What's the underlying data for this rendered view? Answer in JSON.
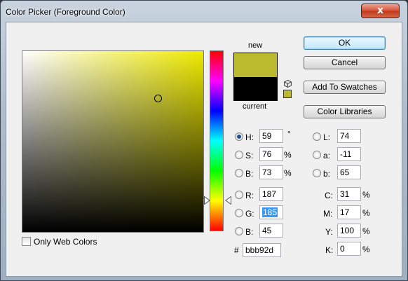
{
  "window": {
    "title": "Color Picker (Foreground Color)",
    "close_label": "x"
  },
  "colors": {
    "new": "#bbb92d",
    "current": "#000000"
  },
  "preview": {
    "new_label": "new",
    "current_label": "current"
  },
  "buttons": {
    "ok": "OK",
    "cancel": "Cancel",
    "add_to_swatches": "Add To Swatches",
    "color_libraries": "Color Libraries"
  },
  "hsb": {
    "h": {
      "label": "H:",
      "value": "59",
      "unit": "°"
    },
    "s": {
      "label": "S:",
      "value": "76",
      "unit": "%"
    },
    "b": {
      "label": "B:",
      "value": "73",
      "unit": "%"
    },
    "selected": "H"
  },
  "rgb": {
    "r": {
      "label": "R:",
      "value": "187"
    },
    "g": {
      "label": "G:",
      "value": "185"
    },
    "b": {
      "label": "B:",
      "value": "45"
    }
  },
  "lab": {
    "l": {
      "label": "L:",
      "value": "74"
    },
    "a": {
      "label": "a:",
      "value": "-11"
    },
    "b": {
      "label": "b:",
      "value": "65"
    }
  },
  "cmyk": {
    "c": {
      "label": "C:",
      "value": "31",
      "unit": "%"
    },
    "m": {
      "label": "M:",
      "value": "17",
      "unit": "%"
    },
    "y": {
      "label": "Y:",
      "value": "100",
      "unit": "%"
    },
    "k": {
      "label": "K:",
      "value": "0",
      "unit": "%"
    }
  },
  "hex": {
    "label": "#",
    "value": "bbb92d"
  },
  "web_colors": {
    "label": "Only Web Colors",
    "checked": false
  }
}
